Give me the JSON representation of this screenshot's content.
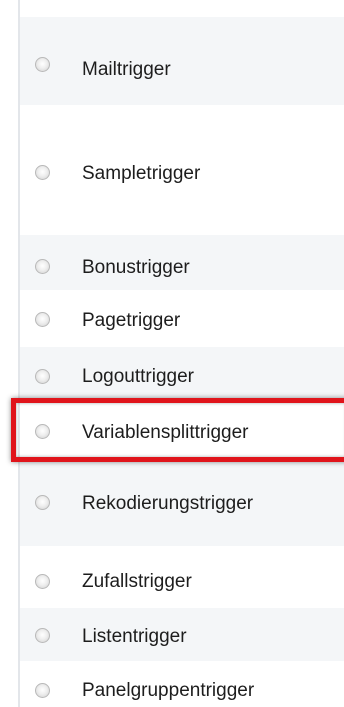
{
  "triggers": {
    "items": [
      {
        "label": "Mailtrigger"
      },
      {
        "label": "Sampletrigger"
      },
      {
        "label": "Bonustrigger"
      },
      {
        "label": "Pagetrigger"
      },
      {
        "label": "Logouttrigger"
      },
      {
        "label": "Variablensplittrigger"
      },
      {
        "label": "Rekodierungstrigger"
      },
      {
        "label": "Zufallstrigger"
      },
      {
        "label": "Listentrigger"
      },
      {
        "label": "Panelgruppentrigger"
      }
    ],
    "highlighted_item": "Variablensplittrigger",
    "highlight_color": "#e0141b",
    "radio_style": "unselected"
  }
}
